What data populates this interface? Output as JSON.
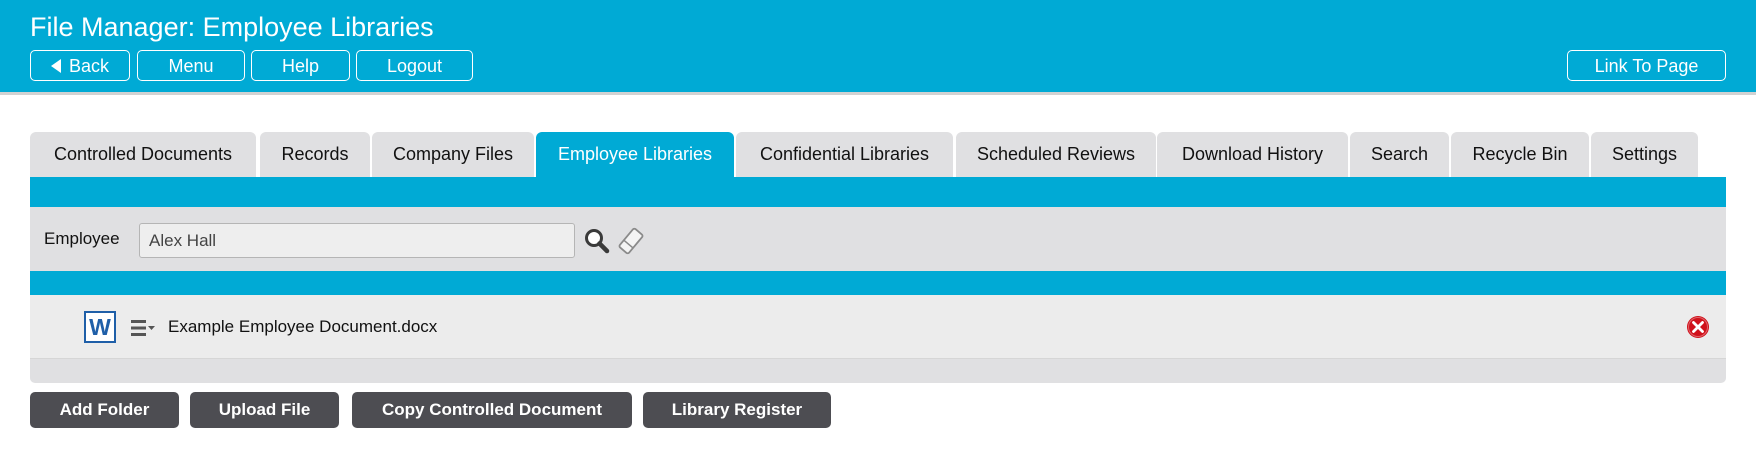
{
  "header": {
    "title": "File Manager: Employee Libraries",
    "buttons": {
      "back": "Back",
      "menu": "Menu",
      "help": "Help",
      "logout": "Logout",
      "link_to_page": "Link To Page"
    }
  },
  "tabs": [
    {
      "label": "Controlled Documents",
      "active": false
    },
    {
      "label": "Records",
      "active": false
    },
    {
      "label": "Company Files",
      "active": false
    },
    {
      "label": "Employee Libraries",
      "active": true
    },
    {
      "label": "Confidential Libraries",
      "active": false
    },
    {
      "label": "Scheduled Reviews",
      "active": false
    },
    {
      "label": "Download History",
      "active": false
    },
    {
      "label": "Search",
      "active": false
    },
    {
      "label": "Recycle Bin",
      "active": false
    },
    {
      "label": "Settings",
      "active": false
    }
  ],
  "filter": {
    "label": "Employee",
    "value": "Alex Hall"
  },
  "files": [
    {
      "name": "Example Employee Document.docx",
      "icon": "word-doc-icon",
      "icon_letter": "W"
    }
  ],
  "actions": {
    "add_folder": "Add Folder",
    "upload_file": "Upload File",
    "copy_controlled": "Copy Controlled Document",
    "library_register": "Library Register"
  },
  "colors": {
    "accent": "#00aad5",
    "tab_inactive": "#e0e0e2",
    "button_dark": "#4d4d52",
    "delete": "#d0111b",
    "word_blue": "#1f5fa8"
  }
}
